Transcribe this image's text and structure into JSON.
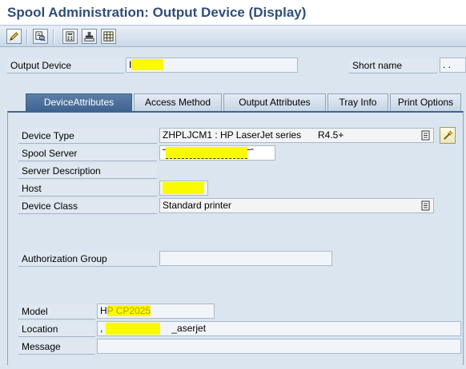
{
  "window": {
    "title": "Spool Administration: Output Device (Display)"
  },
  "toolbar": {
    "buttons": [
      {
        "icon": "pencil-icon"
      },
      {
        "icon": "where-used-icon"
      },
      {
        "icon": "calculator-icon"
      },
      {
        "icon": "stamp-icon"
      },
      {
        "icon": "table-icon"
      }
    ]
  },
  "header": {
    "output_device_label": "Output Device",
    "output_device_value": "I",
    "output_device_redacted": "            ",
    "short_name_label": "Short name",
    "short_name_value": ". ."
  },
  "tabs": [
    {
      "label": "DeviceAttributes",
      "active": true
    },
    {
      "label": "Access Method",
      "active": false
    },
    {
      "label": "Output Attributes",
      "active": false
    },
    {
      "label": "Tray Info",
      "active": false
    },
    {
      "label": "Print Options",
      "active": false
    }
  ],
  "device_attributes": {
    "device_type_label": "Device Type",
    "device_type_value": "ZHPLJCM1 : HP LaserJet series",
    "device_type_release": "R4.5+",
    "spool_server_label": "Spool Server",
    "spool_server_value": "˜",
    "spool_server_suffix": "˜ˆ",
    "server_description_label": "Server Description",
    "host_label": "Host",
    "host_value": "",
    "device_class_label": "Device Class",
    "device_class_value": "Standard printer",
    "authorization_group_label": "Authorization Group",
    "authorization_group_value": "",
    "model_label": "Model",
    "model_prefix": "H",
    "model_value": "P CP2025",
    "location_label": "Location",
    "location_prefix": ",",
    "location_suffix": "_aserjet",
    "message_label": "Message",
    "message_value": ""
  },
  "colors": {
    "title": "#2f4e79",
    "active_tab": "#3f6491",
    "background": "#dbe5ef",
    "highlight": "#fbfb00"
  }
}
